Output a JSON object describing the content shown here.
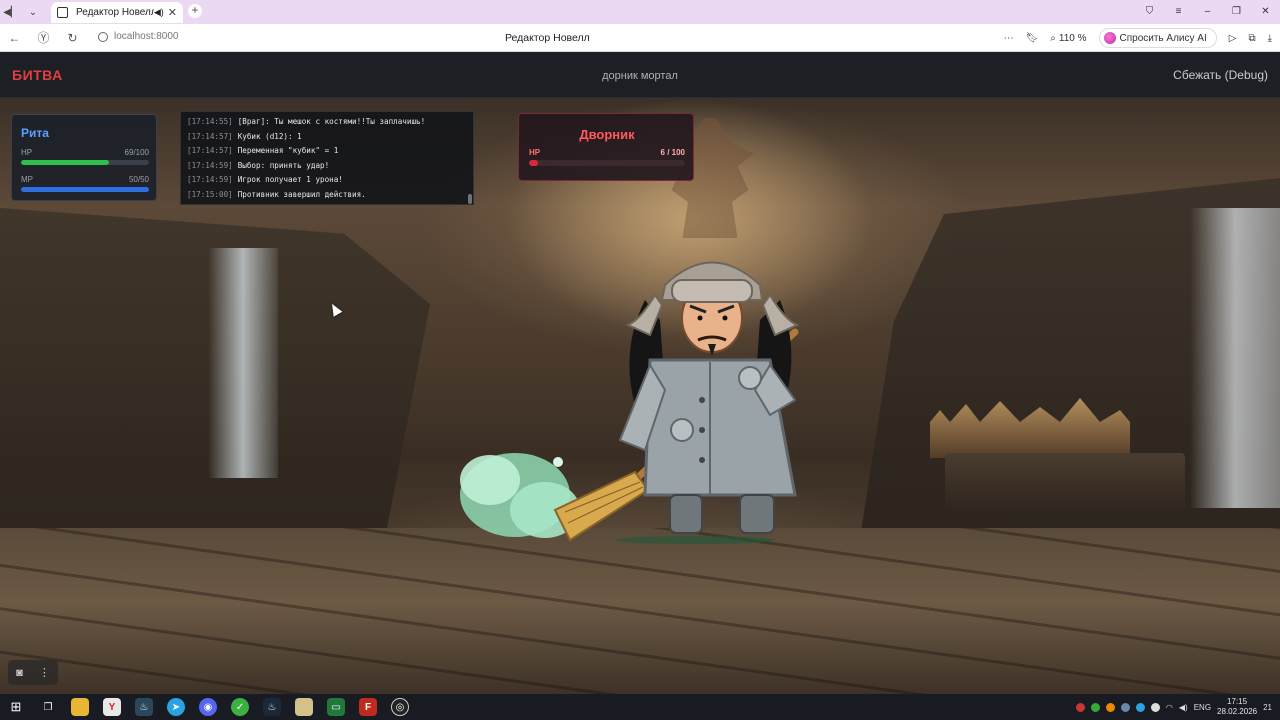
{
  "browser": {
    "tab_title": "Редактор Новелл",
    "url": "localhost:8000",
    "page_title": "Редактор Новелл",
    "zoom": "110 %",
    "alice_label": "Спросить Алису AI"
  },
  "game": {
    "title": "БИТВА",
    "scene_name": "дорник мортал",
    "flee_label": "Сбежать (Debug)"
  },
  "player": {
    "name": "Рита",
    "hp_label": "HP",
    "hp_value": "69/100",
    "hp_fraction": 0.69,
    "mp_label": "MP",
    "mp_value": "50/50",
    "mp_fraction": 1.0
  },
  "enemy": {
    "name": "Дворник",
    "hp_label": "HP",
    "hp_value": "6 / 100",
    "hp_fraction": 0.06
  },
  "log": [
    {
      "time": "[17:14:55]",
      "text": "[Враг]: Ты мешок с костями!!Ты заплачишь!"
    },
    {
      "time": "[17:14:57]",
      "text": "Кубик (d12): 1"
    },
    {
      "time": "[17:14:57]",
      "text": "Переменная \"кубик\" = 1"
    },
    {
      "time": "[17:14:59]",
      "text": "Выбор: принять удар!"
    },
    {
      "time": "[17:14:59]",
      "text": "Игрок получает 1 урона!"
    },
    {
      "time": "[17:15:00]",
      "text": "Противник завершил действия."
    }
  ],
  "taskbar": {
    "lang": "ENG",
    "time": "17:15",
    "date": "28.02.2026",
    "notifications": "21"
  },
  "colors": {
    "accent_red": "#e14040",
    "player_blue": "#5aa2ff",
    "hp_green": "#2fbf4a",
    "mp_blue": "#2f6ee0",
    "enemy_hp_red": "#d62a3a"
  },
  "icons": [
    "speaker-icon",
    "close-icon",
    "plus-icon",
    "back-icon",
    "reload-icon",
    "globe-icon",
    "bookmark-icon",
    "zoom-icon",
    "camera-icon",
    "windows-start-icon"
  ]
}
